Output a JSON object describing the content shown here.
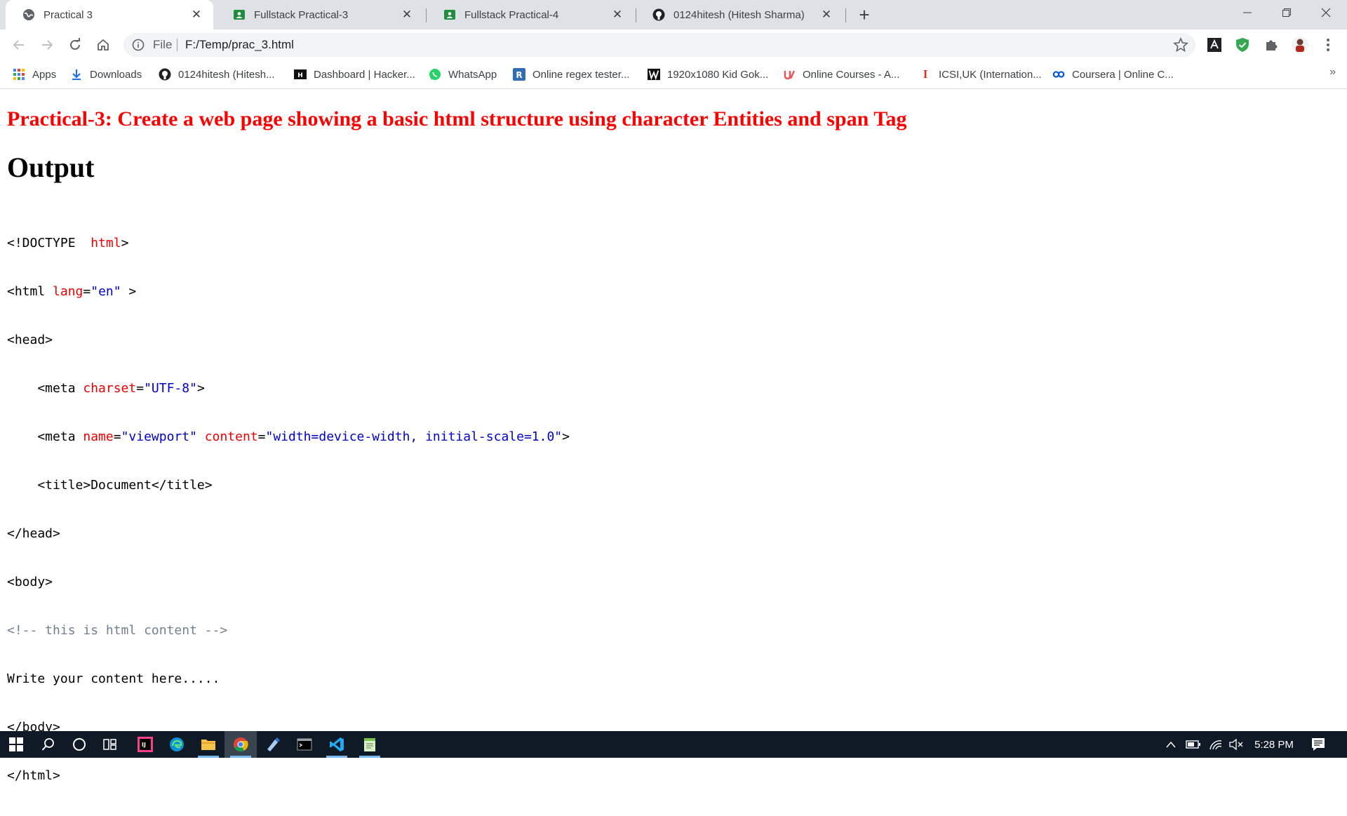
{
  "browser": {
    "tabs": [
      {
        "title": "Practical 3",
        "icon": "globe-icon",
        "active": true
      },
      {
        "title": "Fullstack Practical-3",
        "icon": "classroom-icon",
        "active": false
      },
      {
        "title": "Fullstack Practical-4",
        "icon": "classroom-icon",
        "active": false
      },
      {
        "title": "0124hitesh (Hitesh Sharma)",
        "icon": "github-icon",
        "active": false
      }
    ],
    "address": {
      "scheme_label": "File",
      "url": "F:/Temp/prac_3.html"
    },
    "bookmarks": [
      {
        "label": "Apps",
        "icon": "apps-grid-icon"
      },
      {
        "label": "Downloads",
        "icon": "download-icon"
      },
      {
        "label": "0124hitesh (Hitesh...",
        "icon": "github-icon"
      },
      {
        "label": "Dashboard | Hacker...",
        "icon": "hackerrank-icon"
      },
      {
        "label": "WhatsApp",
        "icon": "whatsapp-icon"
      },
      {
        "label": "Online regex tester...",
        "icon": "regex-icon"
      },
      {
        "label": "1920x1080 Kid Gok...",
        "icon": "wallpaper-icon"
      },
      {
        "label": "Online Courses - A...",
        "icon": "udemy-icon"
      },
      {
        "label": "ICSI,UK (Internation...",
        "icon": "icsi-icon"
      },
      {
        "label": "Coursera | Online C...",
        "icon": "coursera-icon"
      }
    ],
    "bookmarks_overflow": "»"
  },
  "page": {
    "heading": "Practical-3: Create a web page showing a basic html structure using character Entities and span Tag",
    "subheading": "Output",
    "code": {
      "l1_a": "<!DOCTYPE  ",
      "l1_b": "html",
      "l1_c": ">",
      "l2_a": "<html ",
      "l2_b": "lang",
      "l2_c": "=",
      "l2_d": "\"en\"",
      "l2_e": " >",
      "l3": "<head>",
      "l4_a": "    <meta ",
      "l4_b": "charset",
      "l4_c": "=",
      "l4_d": "\"UTF-8\"",
      "l4_e": ">",
      "l5_a": "    <meta ",
      "l5_b": "name",
      "l5_c": "=",
      "l5_d": "\"viewport\"",
      "l5_e": " ",
      "l5_f": "content",
      "l5_g": "=",
      "l5_h": "\"width=device-width, initial-scale=1.0\"",
      "l5_i": ">",
      "l6": "    <title>Document</title>",
      "l7": "</head>",
      "l8": "<body>",
      "l9": "<!-- this is html content -->",
      "l10": "Write your content here.....",
      "l11": "</body>",
      "l12": "</html>"
    }
  },
  "taskbar": {
    "apps": [
      "windows-start-icon",
      "search-icon",
      "cortana-icon",
      "task-view-icon",
      "intellij-icon",
      "edge-icon",
      "file-explorer-icon",
      "chrome-icon",
      "paint-3d-icon",
      "terminal-icon",
      "vscode-icon",
      "notepad-icon"
    ],
    "clock": "5:28 PM"
  }
}
